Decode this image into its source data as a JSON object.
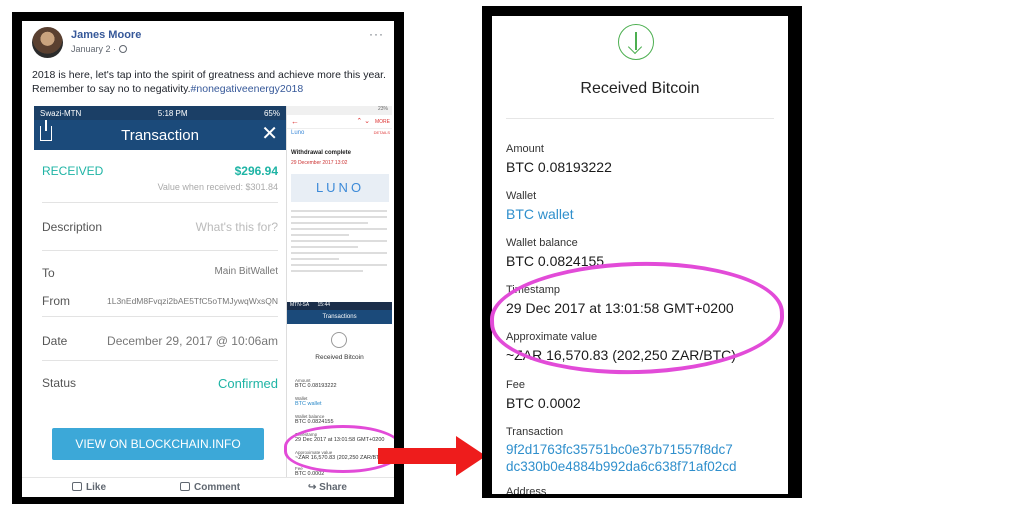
{
  "post": {
    "author": "James Moore",
    "date": "January 2 ·",
    "more": "···",
    "text_line1": "2018 is here, let's tap into the spirit of greatness and achieve more this year.",
    "text_line2": "Remember to say no to negativity.",
    "hashtag": "#nonegativeenergy2018",
    "footer": {
      "like": "Like",
      "comment": "Comment",
      "share": "Share"
    }
  },
  "transaction_screen": {
    "status_left": "Swazi-MTN",
    "status_time": "5:18 PM",
    "status_right": "65%",
    "title": "Transaction",
    "close": "✕",
    "received_label": "RECEIVED",
    "amount": "$296.94",
    "value_when_received": "Value when received: $301.84",
    "description_label": "Description",
    "description_placeholder": "What's this for?",
    "to_label": "To",
    "to_value": "Main BitWallet",
    "from_label": "From",
    "from_value": "1L3nEdM8Fvqzi2bAE5TfC5oTMJywqWxsQN",
    "date_label": "Date",
    "date_value": "December 29, 2017 @ 10:06am",
    "status_label": "Status",
    "status_value": "Confirmed",
    "button": "VIEW ON BLOCKCHAIN.INFO"
  },
  "email_screen": {
    "status": "23%",
    "back": "←",
    "arrows": "⌃ ⌄",
    "more": "MORE",
    "sender": "Luno",
    "details": "DETAILS",
    "subject": "Withdrawal complete",
    "date": "29 December 2017 13:02",
    "logo": "LUNO"
  },
  "mini_received": {
    "status": "MTN-SA",
    "status_time": "15:44",
    "bar": "Transactions",
    "title": "Received Bitcoin",
    "amount_label": "Amount",
    "amount": "BTC 0.08193222",
    "wallet_label": "Wallet",
    "wallet": "BTC wallet",
    "balance_label": "Wallet balance",
    "balance": "BTC 0.0824155",
    "timestamp_label": "Timestamp",
    "timestamp": "29 Dec 2017 at 13:01:58 GMT+0200",
    "approx_label": "Approximate value",
    "approx": "~ZAR 16,570.83 (202,250 ZAR/BTC)",
    "fee_label": "Fee",
    "fee": "BTC 0.0002"
  },
  "zoom": {
    "title": "Received Bitcoin",
    "amount_label": "Amount",
    "amount": "BTC 0.08193222",
    "wallet_label": "Wallet",
    "wallet": "BTC wallet",
    "balance_label": "Wallet balance",
    "balance": "BTC 0.0824155",
    "timestamp_label": "Timestamp",
    "timestamp": "29 Dec 2017 at 13:01:58 GMT+0200",
    "approx_label": "Approximate value",
    "approx": "~ZAR 16,570.83 (202,250 ZAR/BTC)",
    "fee_label": "Fee",
    "fee": "BTC 0.0002",
    "tx_label": "Transaction",
    "tx_line1": "9f2d1763fc35751bc0e37b71557f8dc7",
    "tx_line2": "dc330b0e4884b992da6c638f71af02cd",
    "address_label": "Address"
  },
  "colors": {
    "highlight": "#e24bd8",
    "arrow": "#ee1c1c",
    "accent": "#1fb4a5",
    "link": "#2f8fcc"
  }
}
